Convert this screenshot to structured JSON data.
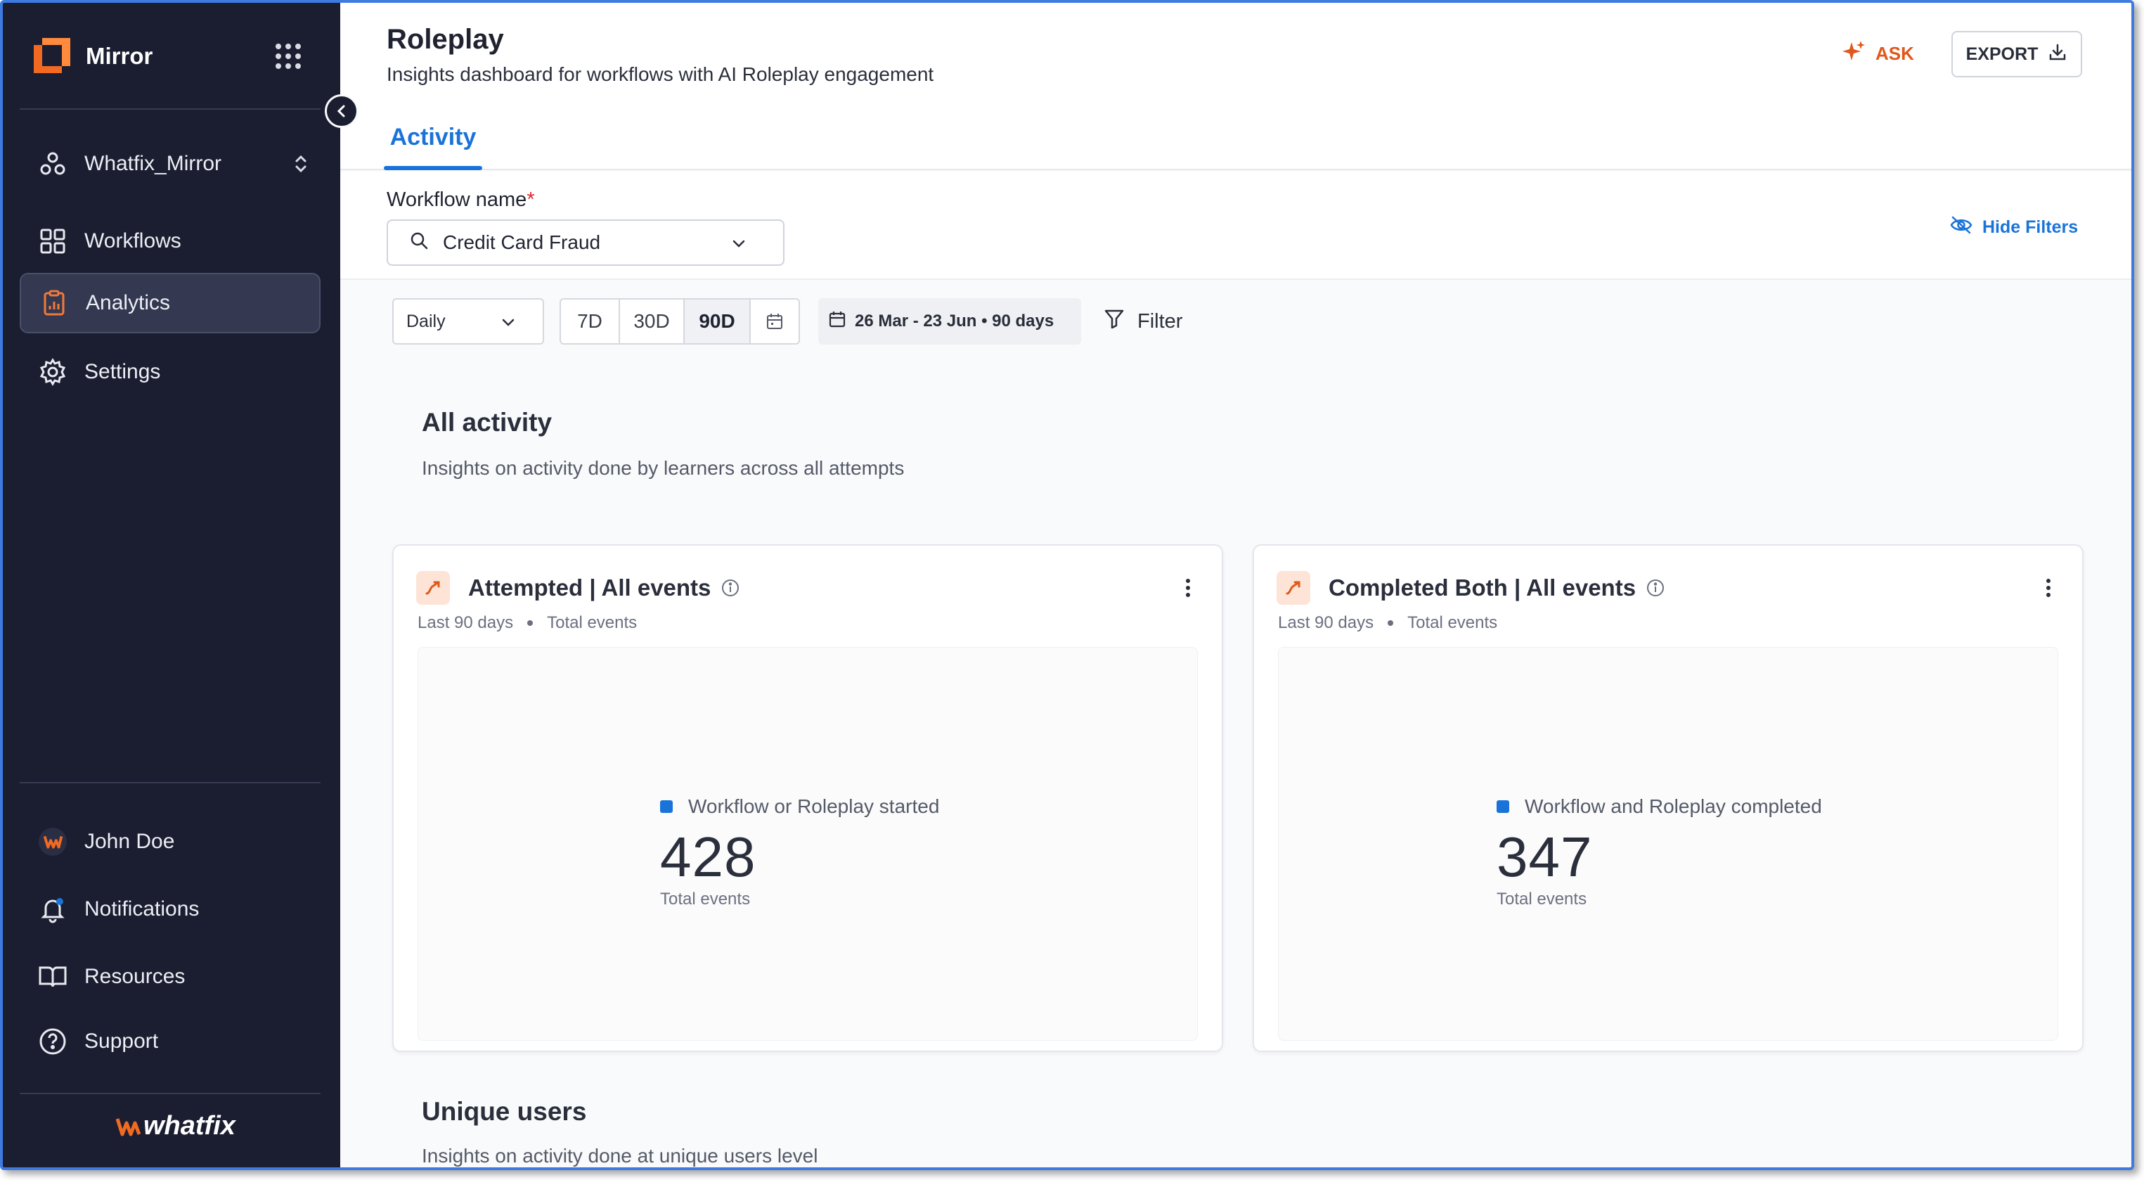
{
  "app": {
    "name": "Mirror",
    "workspace": "Whatfix_Mirror",
    "footer_brand": "whatfix"
  },
  "sidebar": {
    "items": [
      {
        "label": "Workflows",
        "icon": "grid-icon"
      },
      {
        "label": "Analytics",
        "icon": "clipboard-chart-icon",
        "active": true
      },
      {
        "label": "Settings",
        "icon": "gear-icon"
      }
    ],
    "bottom_items": [
      {
        "label": "John Doe",
        "icon": "avatar"
      },
      {
        "label": "Notifications",
        "icon": "bell-icon"
      },
      {
        "label": "Resources",
        "icon": "book-icon"
      },
      {
        "label": "Support",
        "icon": "help-circle-icon"
      }
    ]
  },
  "header": {
    "title": "Roleplay",
    "subtitle": "Insights dashboard for workflows with AI Roleplay engagement",
    "ask_label": "ASK",
    "export_label": "EXPORT",
    "tabs": [
      {
        "label": "Activity",
        "active": true
      }
    ]
  },
  "filters": {
    "workflow_label": "Workflow name",
    "required_mark": "*",
    "workflow_value": "Credit Card Fraud",
    "hide_filters_label": "Hide Filters",
    "granularity_value": "Daily",
    "ranges": [
      "7D",
      "30D",
      "90D"
    ],
    "active_range": "90D",
    "date_range": "26 Mar - 23 Jun • 90 days",
    "filter_label": "Filter"
  },
  "sections": {
    "all_activity": {
      "title": "All activity",
      "subtitle": "Insights on activity done by learners across all attempts"
    },
    "unique_users": {
      "title": "Unique users",
      "subtitle": "Insights on activity done at unique users level"
    }
  },
  "cards": [
    {
      "title": "Attempted | All events",
      "meta_period": "Last 90 days",
      "meta_type": "Total events",
      "legend": "Workflow or Roleplay started",
      "value": "428",
      "unit": "Total events"
    },
    {
      "title": "Completed Both | All events",
      "meta_period": "Last 90 days",
      "meta_type": "Total events",
      "legend": "Workflow and Roleplay completed",
      "value": "347",
      "unit": "Total events"
    }
  ],
  "colors": {
    "sidebar_bg": "#1b1e31",
    "accent_blue": "#1a73d9",
    "accent_orange": "#e0581b"
  }
}
